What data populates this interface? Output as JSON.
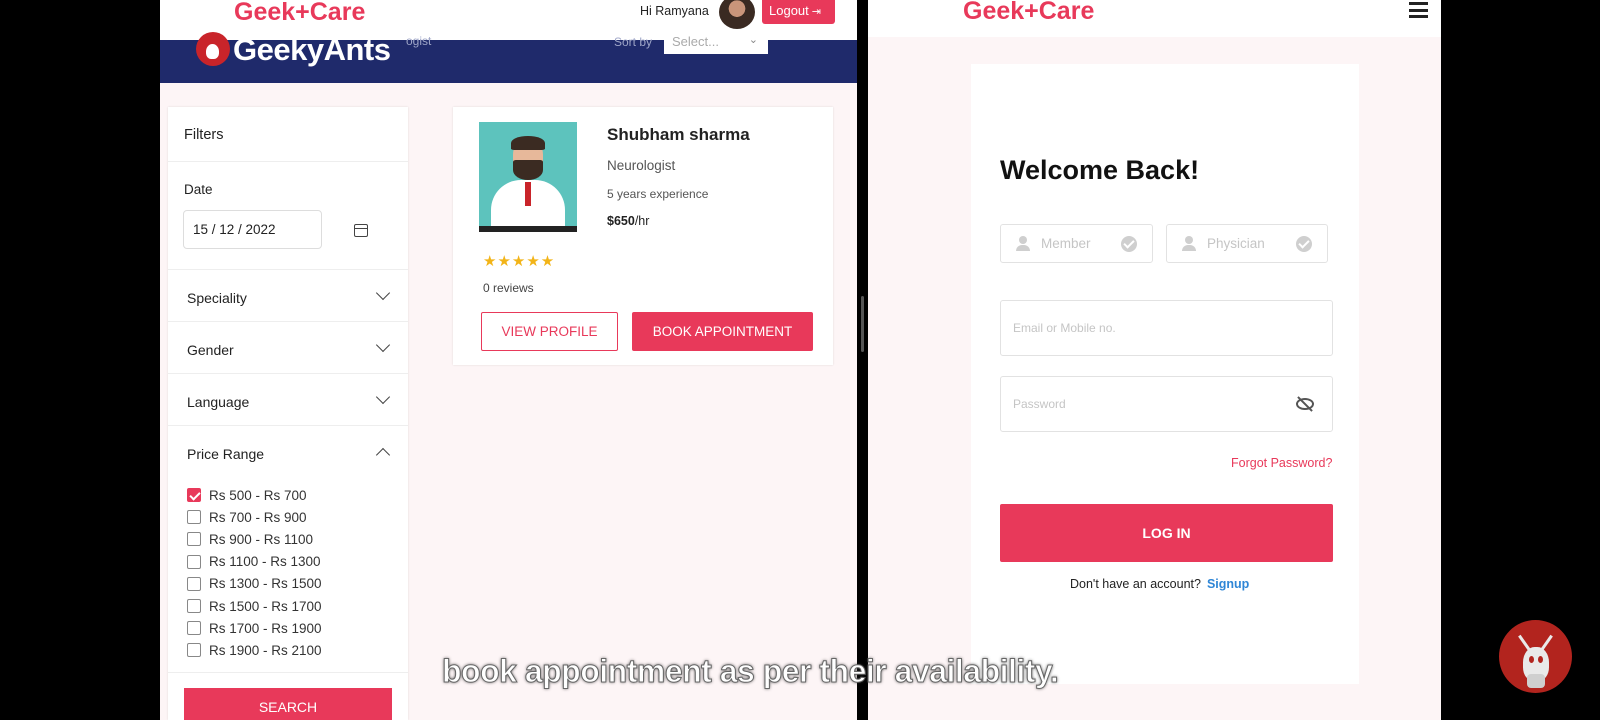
{
  "left": {
    "brand": "Geek+Care",
    "greeting": "Hi Ramyana",
    "logout_label": "Logout",
    "logo_text": "GeekyAnts",
    "band_faint_text": "ogist",
    "sort_label": "Sort by",
    "sort_select_value": "Select...",
    "filters": {
      "title": "Filters",
      "date_label": "Date",
      "date_value": "15 / 12 / 2022",
      "sections": [
        "Speciality",
        "Gender",
        "Language",
        "Price Range"
      ],
      "price_ranges": [
        {
          "label": "Rs 500 - Rs 700",
          "checked": true
        },
        {
          "label": "Rs 700 - Rs 900",
          "checked": false
        },
        {
          "label": "Rs 900 - Rs 1100",
          "checked": false
        },
        {
          "label": "Rs 1100 - Rs 1300",
          "checked": false
        },
        {
          "label": "Rs 1300 - Rs 1500",
          "checked": false
        },
        {
          "label": "Rs 1500 - Rs 1700",
          "checked": false
        },
        {
          "label": "Rs 1700 - Rs 1900",
          "checked": false
        },
        {
          "label": "Rs 1900 - Rs 2100",
          "checked": false
        }
      ],
      "search_label": "SEARCH"
    },
    "doctor": {
      "name": "Shubham sharma",
      "speciality": "Neurologist",
      "experience": "5 years experience",
      "price": "$650",
      "price_unit": "/hr",
      "stars": "★★★★★",
      "rating": 5,
      "reviews": "0 reviews",
      "view_profile_label": "VIEW PROFILE",
      "book_label": "BOOK APPOINTMENT"
    }
  },
  "right": {
    "brand": "Geek+Care",
    "welcome": "Welcome Back!",
    "role_member": "Member",
    "role_physician": "Physician",
    "email_placeholder": "Email or Mobile no.",
    "password_placeholder": "Password",
    "forgot_label": "Forgot Password?",
    "login_label": "LOG IN",
    "no_account_text": "Don't have an account?",
    "signup_label": "Signup"
  },
  "caption": "book appointment as per their availability.",
  "colors": {
    "accent": "#e8395a",
    "navy": "#1f2a6b",
    "link_blue": "#2f86d6",
    "star": "#f2b418"
  },
  "icons": [
    "calendar-icon",
    "chevron-down-icon",
    "chevron-up-icon",
    "logout-icon",
    "user-icon",
    "check-circle-icon",
    "eye-off-icon",
    "hamburger-menu-icon",
    "star-icon"
  ]
}
